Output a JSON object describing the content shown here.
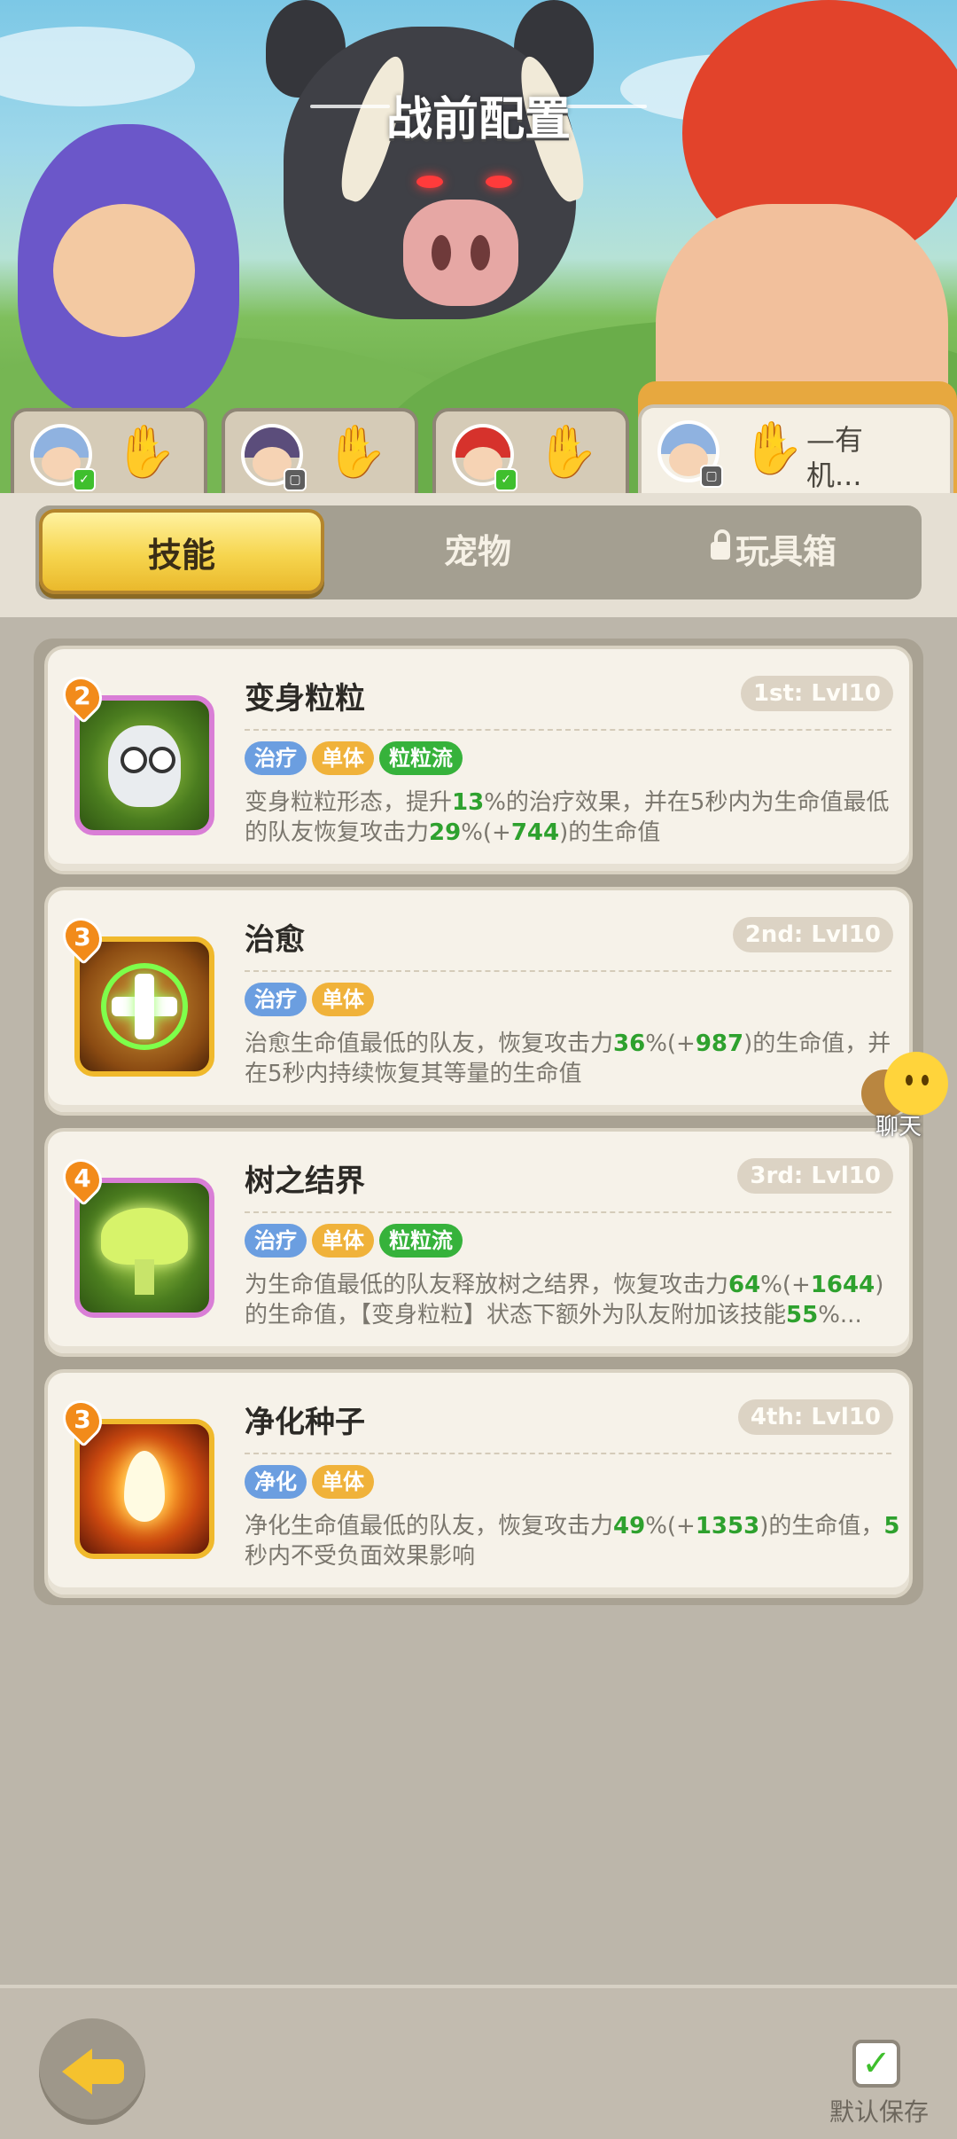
{
  "header": {
    "title": "战前配置"
  },
  "hero_tabs": [
    {
      "name": "",
      "badge": "green",
      "hair_color": "#8fb2e0"
    },
    {
      "name": "",
      "badge": "gray",
      "hair_color": "#5b4d7b"
    },
    {
      "name": "",
      "badge": "green",
      "hair_color": "#d6322c"
    },
    {
      "name": "—有机...",
      "badge": "gray",
      "hair_color": "#8fb2e0"
    }
  ],
  "segments": {
    "skills": "技能",
    "pets": "宠物",
    "toybox": "玩具箱",
    "active": "skills"
  },
  "skills": [
    {
      "cost": "2",
      "name": "变身粒粒",
      "level": "1st: Lvl10",
      "tags": [
        "治疗",
        "单体",
        "粒粒流"
      ],
      "desc": [
        {
          "t": "变身粒粒形态，提升"
        },
        {
          "t": "13",
          "g": true
        },
        {
          "t": "%的治疗效果，并在5秒内为生命值最低的队友恢复攻击力"
        },
        {
          "t": "29",
          "g": true
        },
        {
          "t": "%(+"
        },
        {
          "t": "744",
          "g": true
        },
        {
          "t": ")的生命值"
        }
      ]
    },
    {
      "cost": "3",
      "name": "治愈",
      "level": "2nd: Lvl10",
      "tags": [
        "治疗",
        "单体"
      ],
      "desc": [
        {
          "t": "治愈生命值最低的队友，恢复攻击力"
        },
        {
          "t": "36",
          "g": true
        },
        {
          "t": "%(+"
        },
        {
          "t": "987",
          "g": true
        },
        {
          "t": ")的生命值，并在5秒内持续恢复其等量的生命值"
        }
      ]
    },
    {
      "cost": "4",
      "name": "树之结界",
      "level": "3rd: Lvl10",
      "tags": [
        "治疗",
        "单体",
        "粒粒流"
      ],
      "desc": [
        {
          "t": "为生命值最低的队友释放树之结界，恢复攻击力"
        },
        {
          "t": "64",
          "g": true
        },
        {
          "t": "%(+"
        },
        {
          "t": "1644",
          "g": true
        },
        {
          "t": ")的生命值，【变身粒粒】状态下额外为队友附加该技能"
        },
        {
          "t": "55",
          "g": true
        },
        {
          "t": "%..."
        }
      ]
    },
    {
      "cost": "3",
      "name": "净化种子",
      "level": "4th: Lvl10",
      "tags": [
        "净化",
        "单体"
      ],
      "desc": [
        {
          "t": "净化生命值最低的队友，恢复攻击力"
        },
        {
          "t": "49",
          "g": true
        },
        {
          "t": "%(+"
        },
        {
          "t": "1353",
          "g": true
        },
        {
          "t": ")的生命值，"
        },
        {
          "t": "5",
          "g": true
        },
        {
          "t": "秒内不受负面效果影响"
        }
      ]
    }
  ],
  "chat": {
    "label": "聊天"
  },
  "footer": {
    "save_label": "默认保存",
    "save_checked": true
  },
  "icons": {
    "back": "arrow-left-icon",
    "save": "checkbox-checked-icon",
    "lock": "lock-icon",
    "chat": "chat-bubble-icon"
  }
}
